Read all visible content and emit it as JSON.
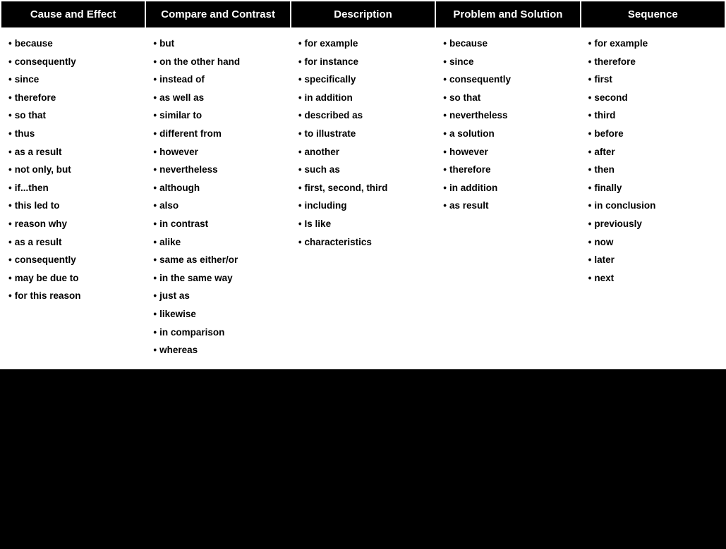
{
  "columns": [
    {
      "id": "cause-effect",
      "header": "Cause and Effect",
      "items": [
        "because",
        "consequently",
        "since",
        "therefore",
        "so that",
        "thus",
        "as a result",
        "not only, but",
        "if...then",
        "this led to",
        "reason why",
        "as a result",
        "consequently",
        "may be due to",
        "for this reason"
      ]
    },
    {
      "id": "compare-contrast",
      "header": "Compare and Contrast",
      "items": [
        "but",
        "on the other hand",
        "instead of",
        "as well as",
        "similar to",
        "different from",
        "however",
        "nevertheless",
        "although",
        "also",
        "in contrast",
        "alike",
        "same as either/or",
        "in the same way",
        "just as",
        "likewise",
        "in comparison",
        "whereas"
      ]
    },
    {
      "id": "description",
      "header": "Description",
      "items": [
        "for example",
        "for instance",
        "specifically",
        "in addition",
        "described as",
        "to illustrate",
        "another",
        "such as",
        "first, second, third",
        "including",
        "Is like",
        "characteristics"
      ]
    },
    {
      "id": "problem-solution",
      "header": "Problem and Solution",
      "items": [
        "because",
        "since",
        "consequently",
        "so that",
        "nevertheless",
        "a solution",
        "however",
        "therefore",
        "in addition",
        "as result"
      ]
    },
    {
      "id": "sequence",
      "header": "Sequence",
      "items": [
        "for example",
        "therefore",
        "first",
        "second",
        "third",
        "before",
        "after",
        "then",
        "finally",
        "in conclusion",
        "previously",
        "now",
        "later",
        "next"
      ]
    }
  ]
}
